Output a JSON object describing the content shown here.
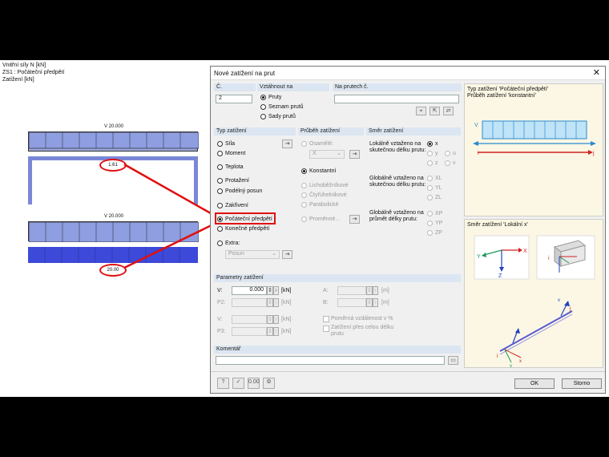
{
  "viewport": {
    "header_lines": [
      "Vnitřní síly N [kN]",
      "ZS1 : Počáteční předpětí",
      "Zatížení [kN]"
    ],
    "top_load_label": "V 20.000",
    "top_result_label": "1.61",
    "bottom_load_label": "V 20.000",
    "bottom_result_label": "20.00"
  },
  "dialog": {
    "title": "Nové zatížení na prut",
    "close_icon": "close-icon",
    "c_header": "Č.",
    "c_value": "2",
    "vztahnout_header": "Vztáhnout na",
    "vztahnout_options": [
      "Pruty",
      "Seznam prutů",
      "Sady prutů"
    ],
    "na_prutech_header": "Na prutech č.",
    "typ_header": "Typ zatížení",
    "typ_options": [
      "Síla",
      "Moment",
      "Teplota",
      "Protažení",
      "Podélný posun",
      "Zakřivení",
      "Počáteční předpětí",
      "Konečné předpětí",
      "Extra:"
    ],
    "extra_value": "Posun",
    "prubeh_header": "Průběh zatížení",
    "prubeh_options": [
      "Osamělé:",
      "Konstantní",
      "Lichoběžníkové",
      "Čtyřúhelníkové",
      "Parabolické",
      "Proměnné..."
    ],
    "osamele_value": "X",
    "smer_header": "Směr zatížení",
    "smer_groups": [
      {
        "label": "Lokálně vztaženo na skutečnou délku prutu:",
        "options": [
          "x",
          "y",
          "z",
          "u",
          "v"
        ]
      },
      {
        "label": "Globálně vztaženo na skutečnou délku prutu:",
        "options": [
          "XL",
          "YL",
          "ZL"
        ]
      },
      {
        "label": "Globálně vztaženo na průmět délky prutu:",
        "options": [
          "XP",
          "YP",
          "ZP"
        ]
      }
    ],
    "param_header": "Parametry zatížení",
    "param_rows": [
      {
        "label": "V:",
        "value": "0.000",
        "unit": "[kN]"
      },
      {
        "label": "P2:",
        "value": "",
        "unit": "[kN]"
      },
      {
        "label": "V:",
        "value": "",
        "unit": "[kN]"
      },
      {
        "label": "P3:",
        "value": "",
        "unit": "[kN]"
      }
    ],
    "param_right": [
      {
        "label": "A:",
        "unit": "[m]"
      },
      {
        "label": "B:",
        "unit": "[m]"
      }
    ],
    "checkbox_pomerna": "Poměrná vzdálenost v %",
    "checkbox_celou": "Zatížení přes celou délku prutu",
    "komentar_header": "Komentář",
    "komentar_value": "",
    "preview_top_title": "Typ zatížení 'Počáteční předpětí'",
    "preview_top_subtitle": "Průběh zatížení 'konstantní'",
    "preview_axis_v": "V",
    "preview_axis_i": "i",
    "preview_axis_j": "j",
    "preview_bottom_title": "Směr zatížení 'Lokální x'",
    "ok_label": "OK",
    "cancel_label": "Storno",
    "colors": {
      "accent": "#1e73c8",
      "highlight": "#e01010",
      "load_fill": "#8aa0e6",
      "preview_bg": "#fbf7e4"
    }
  }
}
